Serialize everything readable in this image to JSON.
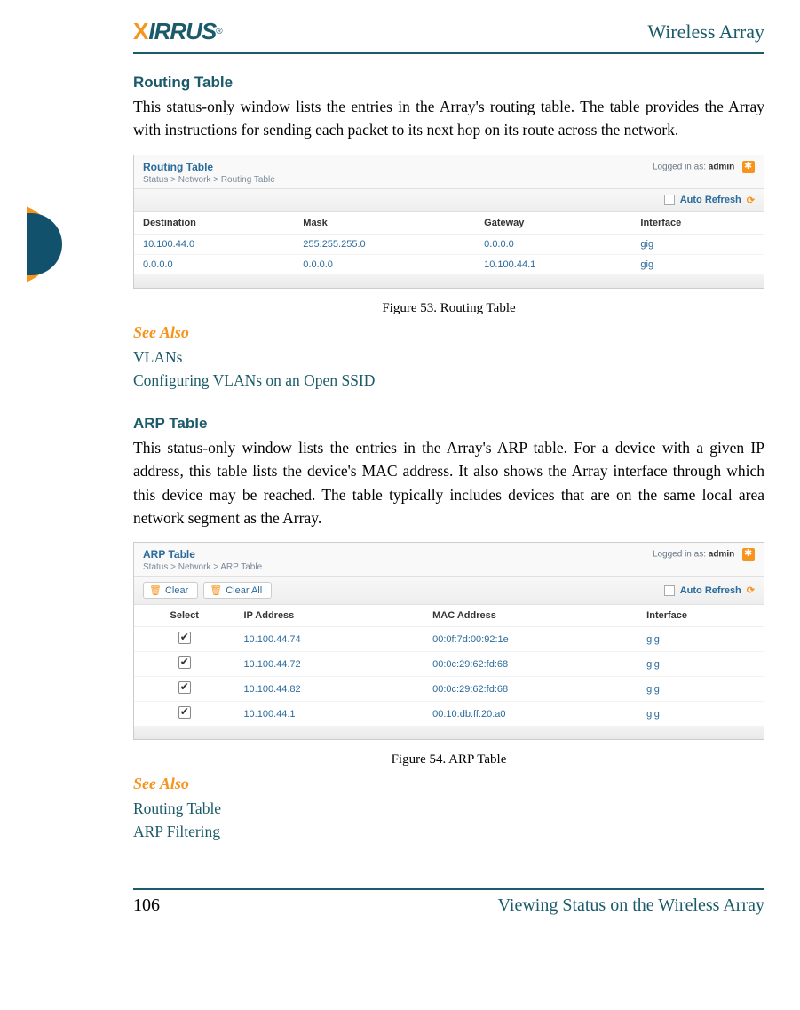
{
  "header": {
    "logo_text": "XIRRUS",
    "product_name": "Wireless Array"
  },
  "section1": {
    "heading": "Routing Table",
    "paragraph": "This status-only window lists the entries in the Array's routing table. The table provides the Array with instructions for sending each packet to its next hop on its route across the network."
  },
  "routing_screenshot": {
    "title": "Routing Table",
    "breadcrumb": "Status > Network > Routing Table",
    "logged_in_prefix": "Logged in as: ",
    "logged_in_user": "admin",
    "auto_refresh_label": "Auto Refresh",
    "columns": [
      "Destination",
      "Mask",
      "Gateway",
      "Interface"
    ],
    "rows": [
      {
        "dest": "10.100.44.0",
        "mask": "255.255.255.0",
        "gw": "0.0.0.0",
        "iface": "gig"
      },
      {
        "dest": "0.0.0.0",
        "mask": "0.0.0.0",
        "gw": "10.100.44.1",
        "iface": "gig"
      }
    ]
  },
  "figure53_caption": "Figure 53. Routing Table",
  "see_also_1": {
    "heading": "See Also",
    "links": [
      "VLANs",
      "Configuring VLANs on an Open SSID"
    ]
  },
  "section2": {
    "heading": "ARP Table",
    "paragraph": "This status-only window lists the entries in the Array's ARP table. For a device with a given IP address, this table lists the device's MAC address. It also shows the Array interface through which this device may be reached. The table typically includes devices that are on the same local area network segment as the Array."
  },
  "arp_screenshot": {
    "title": "ARP Table",
    "breadcrumb": "Status > Network > ARP Table",
    "logged_in_prefix": "Logged in as: ",
    "logged_in_user": "admin",
    "clear_label": "Clear",
    "clear_all_label": "Clear All",
    "auto_refresh_label": "Auto Refresh",
    "columns": [
      "Select",
      "IP Address",
      "MAC Address",
      "Interface"
    ],
    "rows": [
      {
        "ip": "10.100.44.74",
        "mac": "00:0f:7d:00:92:1e",
        "iface": "gig"
      },
      {
        "ip": "10.100.44.72",
        "mac": "00:0c:29:62:fd:68",
        "iface": "gig"
      },
      {
        "ip": "10.100.44.82",
        "mac": "00:0c:29:62:fd:68",
        "iface": "gig"
      },
      {
        "ip": "10.100.44.1",
        "mac": "00:10:db:ff:20:a0",
        "iface": "gig"
      }
    ]
  },
  "figure54_caption": "Figure 54. ARP Table",
  "see_also_2": {
    "heading": "See Also",
    "links": [
      "Routing Table",
      "ARP Filtering"
    ]
  },
  "footer": {
    "page_number": "106",
    "chapter_title": "Viewing Status on the Wireless Array"
  }
}
